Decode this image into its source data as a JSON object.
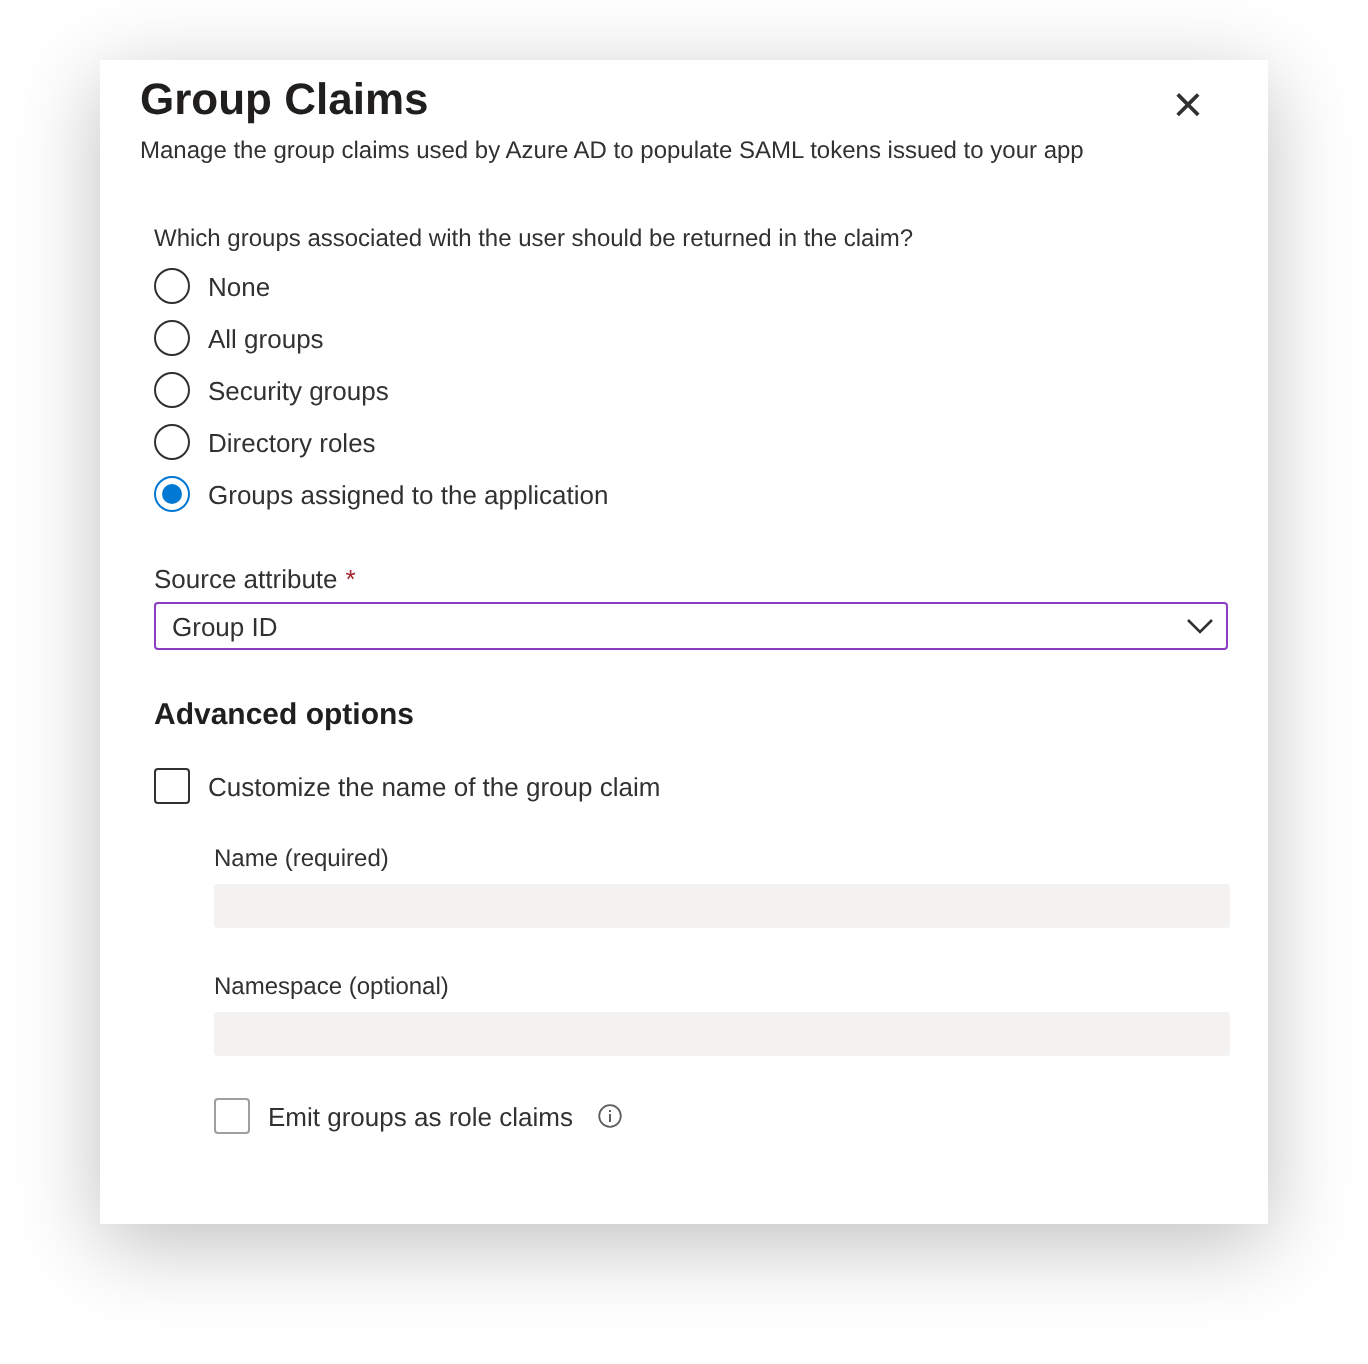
{
  "dialog": {
    "title": "Group Claims",
    "subtitle": "Manage the group claims used by Azure AD to populate SAML tokens issued to your app",
    "close": "×"
  },
  "group_question": "Which groups associated with the user should be returned in the claim?",
  "group_options": [
    {
      "label": "None",
      "selected": false
    },
    {
      "label": "All groups",
      "selected": false
    },
    {
      "label": "Security groups",
      "selected": false
    },
    {
      "label": "Directory roles",
      "selected": false
    },
    {
      "label": "Groups assigned to the application",
      "selected": true
    }
  ],
  "source_attribute": {
    "label": "Source attribute",
    "required_mark": "*",
    "value": "Group ID"
  },
  "advanced": {
    "heading": "Advanced options",
    "customize": {
      "label": "Customize the name of the group claim",
      "checked": false
    },
    "fields": [
      {
        "label": "Name (required)",
        "disabled": true
      },
      {
        "label": "Namespace (optional)",
        "disabled": true
      }
    ],
    "emit": {
      "label": "Emit groups as role claims",
      "checked": false,
      "disabled": true
    }
  }
}
